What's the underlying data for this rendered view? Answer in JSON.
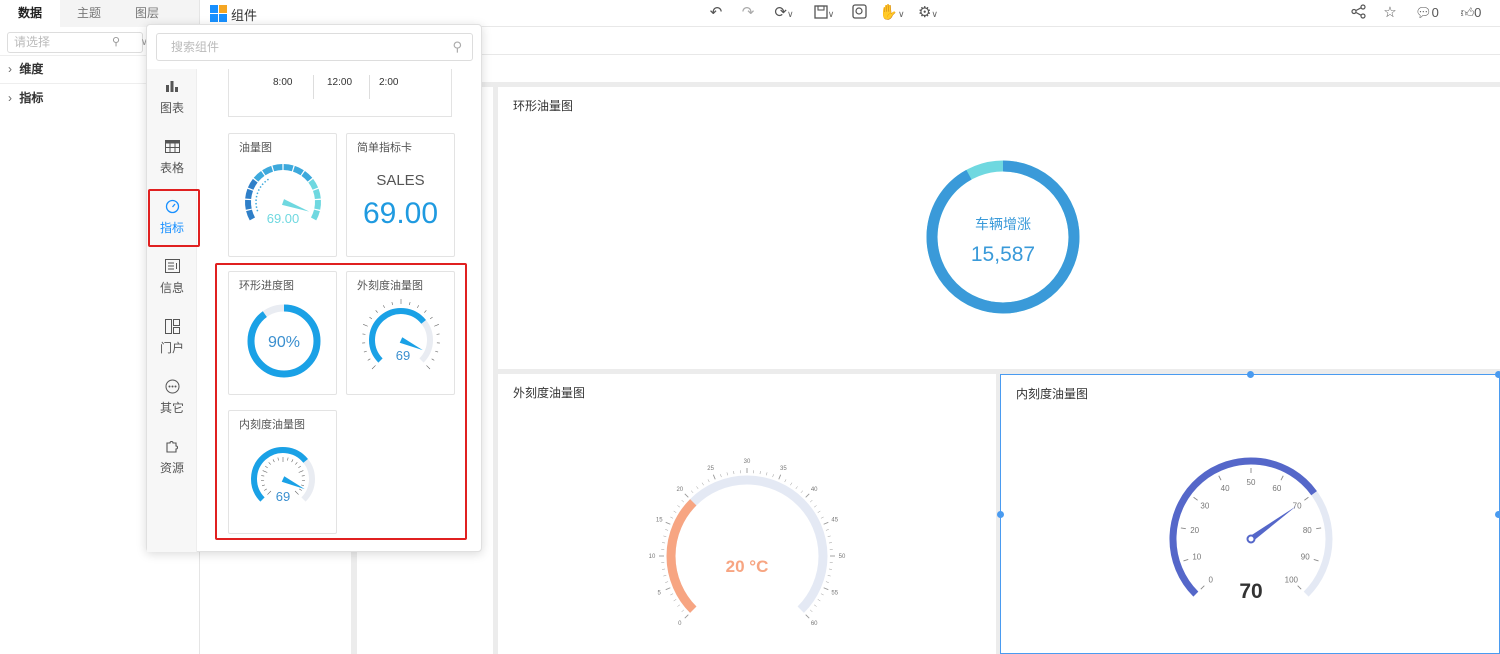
{
  "left_tabs": [
    "数据",
    "主题",
    "图层"
  ],
  "component_menu_label": "组件",
  "toolbar": {
    "comment_count": "0",
    "like_count": "0"
  },
  "left_panel": {
    "select_placeholder": "请选择",
    "tree": [
      "维度",
      "指标"
    ]
  },
  "popup": {
    "search_placeholder": "搜索组件",
    "nav": [
      "图表",
      "表格",
      "指标",
      "信息",
      "门户",
      "其它",
      "资源"
    ],
    "partial_tile_times": [
      "8:00",
      "12:00",
      "2:00"
    ],
    "tiles": {
      "gauge": {
        "title": "油量图",
        "value": "69.00"
      },
      "kpi": {
        "title": "简单指标卡",
        "label": "SALES",
        "value": "69.00"
      },
      "ring": {
        "title": "环形进度图",
        "value": "90%"
      },
      "outer": {
        "title": "外刻度油量图",
        "value": "69"
      },
      "inner": {
        "title": "内刻度油量图",
        "value": "69"
      }
    }
  },
  "canvas": {
    "ring_card": {
      "title": "环形油量图",
      "label": "车辆增涨",
      "value": "15,587",
      "fraction": 0.92
    },
    "outer_card": {
      "title": "外刻度油量图",
      "value_text": "20 °C",
      "value": 20,
      "min": 0,
      "max": 60,
      "ticks": [
        "0",
        "5",
        "10",
        "15",
        "20",
        "25",
        "30",
        "35",
        "40",
        "45",
        "50",
        "55",
        "60"
      ]
    },
    "inner_card": {
      "title": "内刻度油量图",
      "value_text": "70",
      "value": 70,
      "min": 0,
      "max": 100,
      "ticks": [
        "0",
        "10",
        "20",
        "30",
        "40",
        "50",
        "60",
        "70",
        "80",
        "90",
        "100"
      ]
    }
  },
  "colors": {
    "accent": "#1890ff",
    "ring": "#3a9ad9",
    "ring_light": "#6fd8e0",
    "orange": "#f7a582",
    "indigo": "#5567c9",
    "track": "#e4e9f4",
    "red": "#e02020"
  }
}
